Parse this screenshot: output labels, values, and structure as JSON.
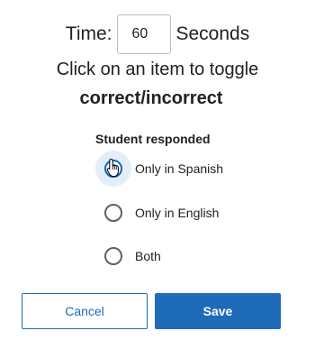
{
  "time": {
    "label": "Time:",
    "value": "60",
    "unit": "Seconds"
  },
  "instructions": {
    "line1": "Click on an item to toggle",
    "line2": "correct/incorrect"
  },
  "response": {
    "group_label": "Student responded",
    "selected_index": 0,
    "options": [
      {
        "label": "Only in Spanish",
        "checked": true
      },
      {
        "label": "Only in English",
        "checked": false
      },
      {
        "label": "Both",
        "checked": false
      }
    ]
  },
  "actions": {
    "cancel_label": "Cancel",
    "save_label": "Save"
  },
  "colors": {
    "accent": "#1e6bb8",
    "radio_checked": "#1565c0",
    "focus_halo": "#e3eef9"
  }
}
